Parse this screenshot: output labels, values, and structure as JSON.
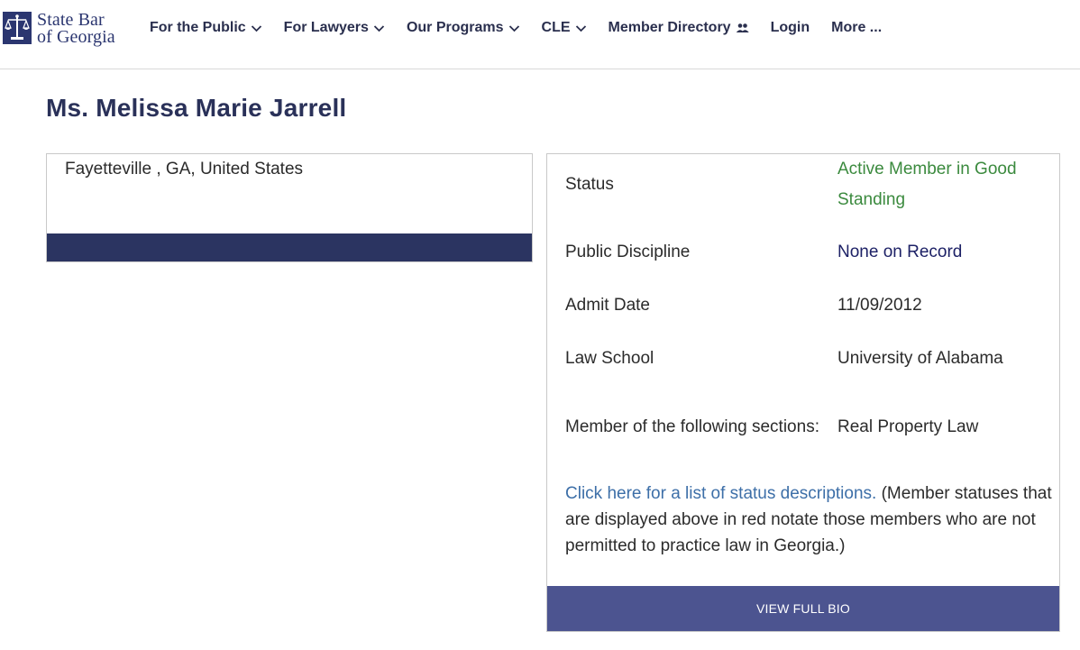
{
  "header": {
    "logo": {
      "line1": "State Bar",
      "line2": "of Georgia"
    },
    "nav": [
      {
        "label": "For the Public",
        "icon": "chevron-down-icon"
      },
      {
        "label": "For Lawyers",
        "icon": "chevron-down-icon"
      },
      {
        "label": "Our Programs",
        "icon": "chevron-down-icon"
      },
      {
        "label": "CLE",
        "icon": "chevron-down-icon"
      },
      {
        "label": "Member Directory",
        "icon": "people-icon"
      },
      {
        "label": "Login"
      },
      {
        "label": "More ..."
      }
    ]
  },
  "profile": {
    "name": "Ms. Melissa Marie Jarrell",
    "location": "Fayetteville , GA, United States"
  },
  "details": {
    "status_label": "Status",
    "status_value": "Active Member in Good Standing",
    "discipline_label": "Public Discipline",
    "discipline_value": "None on Record",
    "admit_label": "Admit Date",
    "admit_value": "11/09/2012",
    "school_label": "Law School",
    "school_value": "University of Alabama",
    "sections_label": "Member of the following sections:",
    "sections_value": "Real Property Law",
    "note_link": "Click here for a list of status descriptions.",
    "note_text": " (Member statuses that are displayed above in red notate those members who are not permitted to practice law in Georgia.)",
    "bio_button": "VIEW FULL BIO"
  },
  "colors": {
    "brand_navy": "#2b3670",
    "status_green": "#3b8a3e",
    "link_blue": "#3d6fa8",
    "button_purple": "#4c5490"
  }
}
